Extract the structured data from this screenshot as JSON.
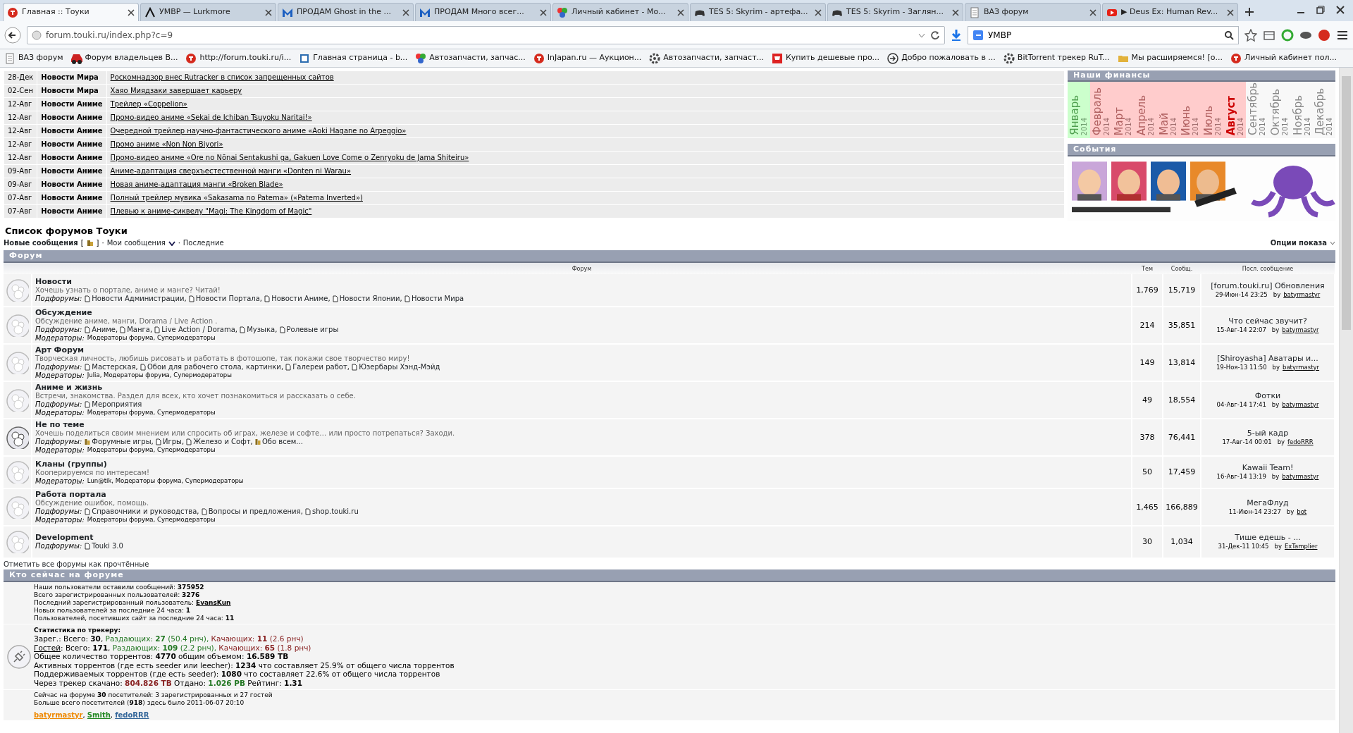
{
  "browser": {
    "tabs": [
      {
        "title": "Главная :: Тоуки",
        "kind": "touki",
        "selected": true
      },
      {
        "title": "УМВР — Lurkmore",
        "kind": "lurk",
        "selected": false
      },
      {
        "title": "ПРОДАМ Ghost in the ...",
        "kind": "m",
        "selected": false
      },
      {
        "title": "ПРОДАМ Много всег...",
        "kind": "m",
        "selected": false
      },
      {
        "title": "Личный кабинет - Mo...",
        "kind": "ball",
        "selected": false
      },
      {
        "title": "TES 5: Skyrim - артефа...",
        "kind": "gamepad",
        "selected": false
      },
      {
        "title": "TES 5: Skyrim - Заглян...",
        "kind": "gamepad",
        "selected": false
      },
      {
        "title": "ВАЗ форум",
        "kind": "doc",
        "selected": false
      },
      {
        "title": "▶ Deus Ex: Human Rev...",
        "kind": "youtube",
        "selected": false
      }
    ],
    "url": "forum.touki.ru/index.php?c=9",
    "search": "УМВР",
    "bookmarks": [
      {
        "title": "ВАЗ форум",
        "kind": "doc"
      },
      {
        "title": "Форум владельцев В...",
        "kind": "car"
      },
      {
        "title": "http://forum.touki.ru/i...",
        "kind": "touki"
      },
      {
        "title": "Главная страница - b...",
        "kind": "page"
      },
      {
        "title": "Автозапчасти, запчас...",
        "kind": "ball"
      },
      {
        "title": "InJapan.ru — Аукцион...",
        "kind": "touki"
      },
      {
        "title": "Автозапчасти, запчаст...",
        "kind": "gear"
      },
      {
        "title": "Купить дешевые про...",
        "kind": "cart"
      },
      {
        "title": "Добро пожаловать в ...",
        "kind": "arrow"
      },
      {
        "title": "BitTorrent трекер RuT...",
        "kind": "gear"
      },
      {
        "title": "Мы расширяемся! [о...",
        "kind": "folder"
      },
      {
        "title": "Личный кабинет пол...",
        "kind": "touki"
      }
    ]
  },
  "news": [
    {
      "date": "28-Дек",
      "category": "Новости Мира",
      "title": "Роскомнадзор внес Rutracker в список запрещенных сайтов"
    },
    {
      "date": "02-Сен",
      "category": "Новости Мира",
      "title": "Хаяо Миядзаки завершает карьеру"
    },
    {
      "date": "12-Авг",
      "category": "Новости Аниме",
      "title": "Трейлер «Coppelion»"
    },
    {
      "date": "12-Авг",
      "category": "Новости Аниме",
      "title": "Промо-видео аниме «Sekai de Ichiban Tsuyoku Naritai!»"
    },
    {
      "date": "12-Авг",
      "category": "Новости Аниме",
      "title": "Очередной трейлер научно-фантастического аниме «Aoki Hagane no Arpeggio»"
    },
    {
      "date": "12-Авг",
      "category": "Новости Аниме",
      "title": "Промо аниме «Non Non Biyori»"
    },
    {
      "date": "12-Авг",
      "category": "Новости Аниме",
      "title": "Промо-видео аниме «Ore no Nōnai Sentakushi ga, Gakuen Love Come o Zenryoku de Jama Shiteiru»"
    },
    {
      "date": "09-Авг",
      "category": "Новости Аниме",
      "title": "Аниме-адаптация сверхъестественной манги «Donten ni Warau»"
    },
    {
      "date": "09-Авг",
      "category": "Новости Аниме",
      "title": "Новая аниме-адаптация манги «Broken Blade»"
    },
    {
      "date": "07-Авг",
      "category": "Новости Аниме",
      "title": "Полный трейлер мувика «Sakasama no Patema» («Patema Inverted»)"
    },
    {
      "date": "07-Авг",
      "category": "Новости Аниме",
      "title": "Плевью к аниме-сиквелу \"Magi: The Kingdom of Magic\""
    }
  ],
  "finances": {
    "title": "Наши финансы",
    "months": [
      {
        "name": "Январь",
        "year": "2014",
        "paid": true,
        "future": false,
        "current": false
      },
      {
        "name": "Февраль",
        "year": "2014",
        "paid": false,
        "future": false,
        "current": false
      },
      {
        "name": "Март",
        "year": "2014",
        "paid": false,
        "future": false,
        "current": false
      },
      {
        "name": "Апрель",
        "year": "2014",
        "paid": false,
        "future": false,
        "current": false
      },
      {
        "name": "Май",
        "year": "2014",
        "paid": false,
        "future": false,
        "current": false
      },
      {
        "name": "Июнь",
        "year": "2014",
        "paid": false,
        "future": false,
        "current": false
      },
      {
        "name": "Июль",
        "year": "2014",
        "paid": false,
        "future": false,
        "current": false
      },
      {
        "name": "Август",
        "year": "2014",
        "paid": false,
        "future": false,
        "current": true
      },
      {
        "name": "Сентябрь",
        "year": "2014",
        "future": true,
        "current": false
      },
      {
        "name": "Октябрь",
        "year": "2014",
        "future": true,
        "current": false
      },
      {
        "name": "Ноябрь",
        "year": "2014",
        "future": true,
        "current": false
      },
      {
        "name": "Декабрь",
        "year": "2014",
        "future": true,
        "current": false
      }
    ]
  },
  "events": {
    "title": "События"
  },
  "forum_list": {
    "title": "Список форумов Тоуки",
    "new_posts": "Новые сообщения",
    "new_posts_mark": "[",
    "new_posts_mark_end": "]",
    "separator": "·",
    "my_posts": "Мои сообщения",
    "latest": "Последние",
    "options": "Опции показа",
    "header": "Форум",
    "columns": [
      "Форум",
      "Тем",
      "Сообщ.",
      "Посл. сообщение"
    ],
    "subforum_separator": ", ",
    "forums": [
      {
        "name": "Новости",
        "description": "Хочешь узнать о портале, аниме и манге? Читай!",
        "has_new": false,
        "subforums_label": "Подфорумы:",
        "subforums": [
          {
            "name": "Новости Администрации",
            "has_new": false
          },
          {
            "name": "Новости Портала",
            "has_new": false
          },
          {
            "name": "Новости Аниме",
            "has_new": false
          },
          {
            "name": "Новости Японии",
            "has_new": false
          },
          {
            "name": "Новости Мира",
            "has_new": false
          }
        ],
        "topics": "1,769",
        "posts": "15,719",
        "last_title": "[forum.touki.ru] Обновления",
        "last_date": "29-Июн-14 23:25",
        "last_by": "by",
        "last_author": "batyrmastyr"
      },
      {
        "name": "Обсуждение",
        "description": "Обсуждение аниме, манги, Dorama / Live Action .",
        "has_new": false,
        "subforums_label": "Подфорумы:",
        "subforums": [
          {
            "name": "Аниме",
            "has_new": false
          },
          {
            "name": "Манга",
            "has_new": false
          },
          {
            "name": "Live Action / Dorama",
            "has_new": false
          },
          {
            "name": "Музыка",
            "has_new": false
          },
          {
            "name": "Ролевые игры",
            "has_new": false
          }
        ],
        "moderators_label": "Модераторы:",
        "moderators": "Модераторы форума, Супермодераторы",
        "topics": "214",
        "posts": "35,851",
        "last_title": "Что сейчас звучит?",
        "last_date": "15-Авг-14 22:07",
        "last_by": "by",
        "last_author": "batyrmastyr"
      },
      {
        "name": "Арт Форум",
        "description": "Творческая личность, любишь рисовать и работать в фотошопе, так покажи свое творчество миру!",
        "has_new": false,
        "subforums_label": "Подфорумы:",
        "subforums": [
          {
            "name": "Мастерская",
            "has_new": false
          },
          {
            "name": "Обои для рабочего стола, картинки",
            "has_new": false
          },
          {
            "name": "Галереи работ",
            "has_new": false
          },
          {
            "name": "Юзербары Хэнд-Мэйд",
            "has_new": false
          }
        ],
        "moderators_label": "Модераторы:",
        "moderators": "Julia, Модераторы форума, Супермодераторы",
        "topics": "149",
        "posts": "13,814",
        "last_title": "[Shiroyasha] Аватары и...",
        "last_date": "19-Ноя-13 11:50",
        "last_by": "by",
        "last_author": "batyrmastyr"
      },
      {
        "name": "Аниме и жизнь",
        "description": "Встречи, знакомства. Раздел для всех, кто хочет познакомиться и рассказать о себе.",
        "has_new": false,
        "subforums_label": "Подфорумы:",
        "subforums": [
          {
            "name": "Мероприятия",
            "has_new": false
          }
        ],
        "moderators_label": "Модераторы:",
        "moderators": "Модераторы форума, Супермодераторы",
        "topics": "49",
        "posts": "18,554",
        "last_title": "Фотки",
        "last_date": "04-Авг-14 17:41",
        "last_by": "by",
        "last_author": "batyrmastyr"
      },
      {
        "name": "Не по теме",
        "description": "Хочешь поделиться своим мнением или спросить об играх, железе и софте… или просто потрепаться? Заходи.",
        "has_new": true,
        "subforums_label": "Подфорумы:",
        "subforums": [
          {
            "name": "Форумные игры",
            "has_new": true
          },
          {
            "name": "Игры",
            "has_new": false
          },
          {
            "name": "Железо и Софт",
            "has_new": false
          },
          {
            "name": "Обо всем...",
            "has_new": true
          }
        ],
        "moderators_label": "Модераторы:",
        "moderators": "Модераторы форума, Супермодераторы",
        "topics": "378",
        "posts": "76,441",
        "last_title": "5-ый кадр",
        "last_date": "17-Авг-14 00:01",
        "last_by": "by",
        "last_author": "fedoRRR"
      },
      {
        "name": "Кланы (группы)",
        "description": "Кооперируемся по интересам!",
        "has_new": false,
        "moderators_label": "Модераторы:",
        "moderators": "Lun@tik, Модераторы форума, Супермодераторы",
        "topics": "50",
        "posts": "17,459",
        "last_title": "Kawaii Team!",
        "last_date": "16-Авг-14 13:19",
        "last_by": "by",
        "last_author": "batyrmastyr"
      },
      {
        "name": "Работа портала",
        "description": "Обсуждение ошибок, помощь.",
        "has_new": false,
        "subforums_label": "Подфорумы:",
        "subforums": [
          {
            "name": "Справочники и руководства",
            "has_new": false
          },
          {
            "name": "Вопросы и предложения",
            "has_new": false
          },
          {
            "name": "shop.touki.ru",
            "has_new": false
          }
        ],
        "moderators_label": "Модераторы:",
        "moderators": "Модераторы форума, Супермодераторы",
        "topics": "1,465",
        "posts": "166,889",
        "last_title": "МегаФлуд",
        "last_date": "11-Июн-14 23:27",
        "last_by": "by",
        "last_author": "bot"
      },
      {
        "name": "Development",
        "has_new": false,
        "subforums_label": "Подфорумы:",
        "subforums": [
          {
            "name": "Touki 3.0",
            "has_new": false
          }
        ],
        "topics": "30",
        "posts": "1,034",
        "last_title": "Тише едешь - ...",
        "last_date": "31-Дек-11 10:45",
        "last_by": "by",
        "last_author": "ExTamplier"
      }
    ],
    "mark_read": "Отметить все форумы как прочтённые"
  },
  "who_online": {
    "title": "Кто сейчас на форуме",
    "site_stats": [
      [
        {
          "kind": "plain",
          "text": "Наши пользователи оставили сообщений: **375952**"
        }
      ],
      [
        {
          "kind": "plain",
          "text": "Всего зарегистрированных пользователей: **3276**"
        }
      ],
      [
        {
          "kind": "plain",
          "text": "Последний зарегистрированный пользователь: "
        },
        {
          "kind": "link",
          "text": "**EvansKun**"
        }
      ],
      [
        {
          "kind": "plain",
          "text": "Новых пользователей за последние 24 часа: **1**"
        }
      ],
      [
        {
          "kind": "plain",
          "text": "Пользователей, посетивших сайт за последние 24 часа: **11**"
        }
      ]
    ],
    "tracker_title": "Статистика по трекеру:",
    "tracker_stats": [
      [
        {
          "kind": "plain",
          "text": "Зарег.: Всего: **30**, "
        },
        {
          "kind": "green",
          "text": "Раздающих: **27** (50.4 рнч), "
        },
        {
          "kind": "red",
          "text": "Качающих: **11** (2.6 рнч)"
        }
      ],
      [
        {
          "kind": "link",
          "text": "Гостей"
        },
        {
          "kind": "plain",
          "text": ": Всего: **171**, "
        },
        {
          "kind": "green",
          "text": "Раздающих: **109** (2.2 рнч), "
        },
        {
          "kind": "red",
          "text": "Качающих: **65** (1.8 рнч)"
        }
      ],
      [
        {
          "kind": "plain",
          "text": "Общее количество торрентов: **4770** общим объемом: **16.589 TB**"
        }
      ],
      [
        {
          "kind": "plain",
          "text": "Активных торрентов (где есть seeder или leecher): **1234** что составляет 25.9% от общего числа торрентов"
        }
      ],
      [
        {
          "kind": "plain",
          "text": "Поддерживаемых торрентов (где есть seeder): **1080** что составляет 22.6% от общего числа торрентов"
        }
      ],
      [
        {
          "kind": "plain",
          "text": "Через трекер скачано: "
        },
        {
          "kind": "red",
          "text": "**804.826 TB**"
        },
        {
          "kind": "plain",
          "text": " Отдано: "
        },
        {
          "kind": "green",
          "text": "**1.026 PB**"
        },
        {
          "kind": "plain",
          "text": " Рейтинг: **1.31**"
        }
      ]
    ],
    "visitors": [
      "Сейчас на форуме **30** посетителей: 3 зарегистрированных и 27 гостей",
      "Больше всего посетителей (**918**) здесь было 2011-06-07 20:10"
    ],
    "online_separator": ", ",
    "online_users": [
      {
        "name": "batyrmastyr",
        "color": "#ee8800"
      },
      {
        "name": "Smith",
        "color": "#228822"
      },
      {
        "name": "fedoRRR",
        "color": "#336699"
      }
    ]
  }
}
